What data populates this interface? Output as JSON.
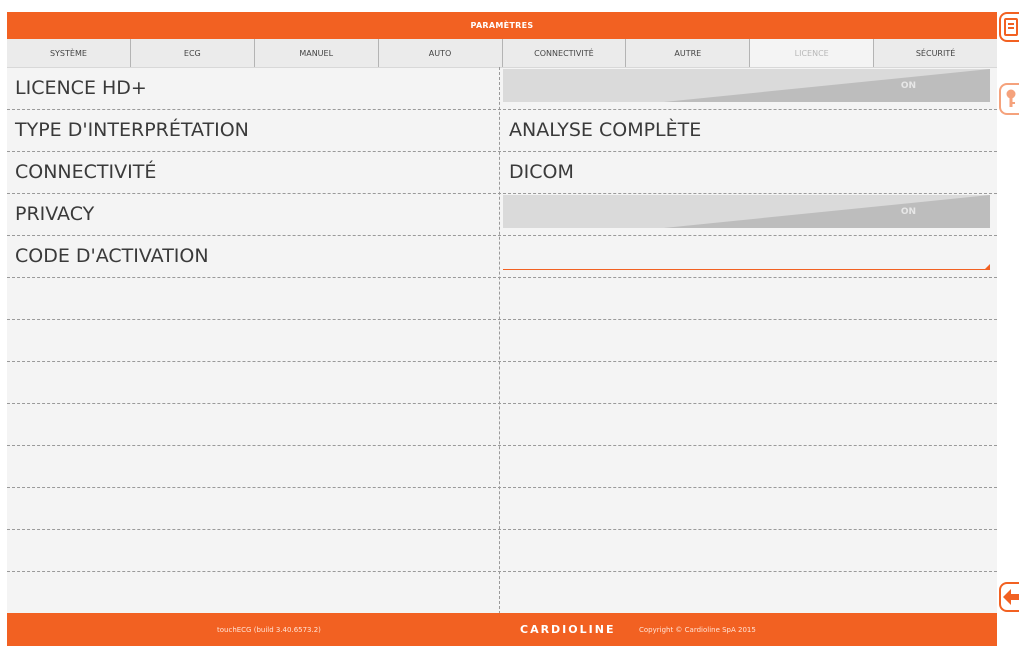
{
  "window": {
    "title": "PARAMÈTRES"
  },
  "tabs": [
    {
      "label": "SYSTÈME",
      "active": false
    },
    {
      "label": "ECG",
      "active": false
    },
    {
      "label": "MANUEL",
      "active": false
    },
    {
      "label": "AUTO",
      "active": false
    },
    {
      "label": "CONNECTIVITÉ",
      "active": false
    },
    {
      "label": "AUTRE",
      "active": false
    },
    {
      "label": "LICENCE",
      "active": true
    },
    {
      "label": "SÉCURITÉ",
      "active": false
    }
  ],
  "rows": [
    {
      "label": "LICENCE HD+",
      "type": "toggle",
      "value": "ON"
    },
    {
      "label": "TYPE D'INTERPRÉTATION",
      "type": "text",
      "value": "ANALYSE COMPLÈTE"
    },
    {
      "label": "CONNECTIVITÉ",
      "type": "text",
      "value": "DICOM"
    },
    {
      "label": "PRIVACY",
      "type": "toggle",
      "value": "ON"
    },
    {
      "label": "CODE D'ACTIVATION",
      "type": "input",
      "value": ""
    }
  ],
  "footer": {
    "build": "touchECG (build 3.40.6573.2)",
    "brand": "CARDIOLINE",
    "copyright": "Copyright © Cardioline SpA 2015"
  },
  "side_buttons": [
    {
      "icon": "save-icon"
    },
    {
      "icon": "key-icon"
    },
    {
      "icon": "back-arrow-icon"
    }
  ],
  "colors": {
    "accent": "#f26122",
    "background": "#f4f4f4",
    "toggle_off": "#dadada",
    "toggle_wedge": "#bdbdbd"
  }
}
